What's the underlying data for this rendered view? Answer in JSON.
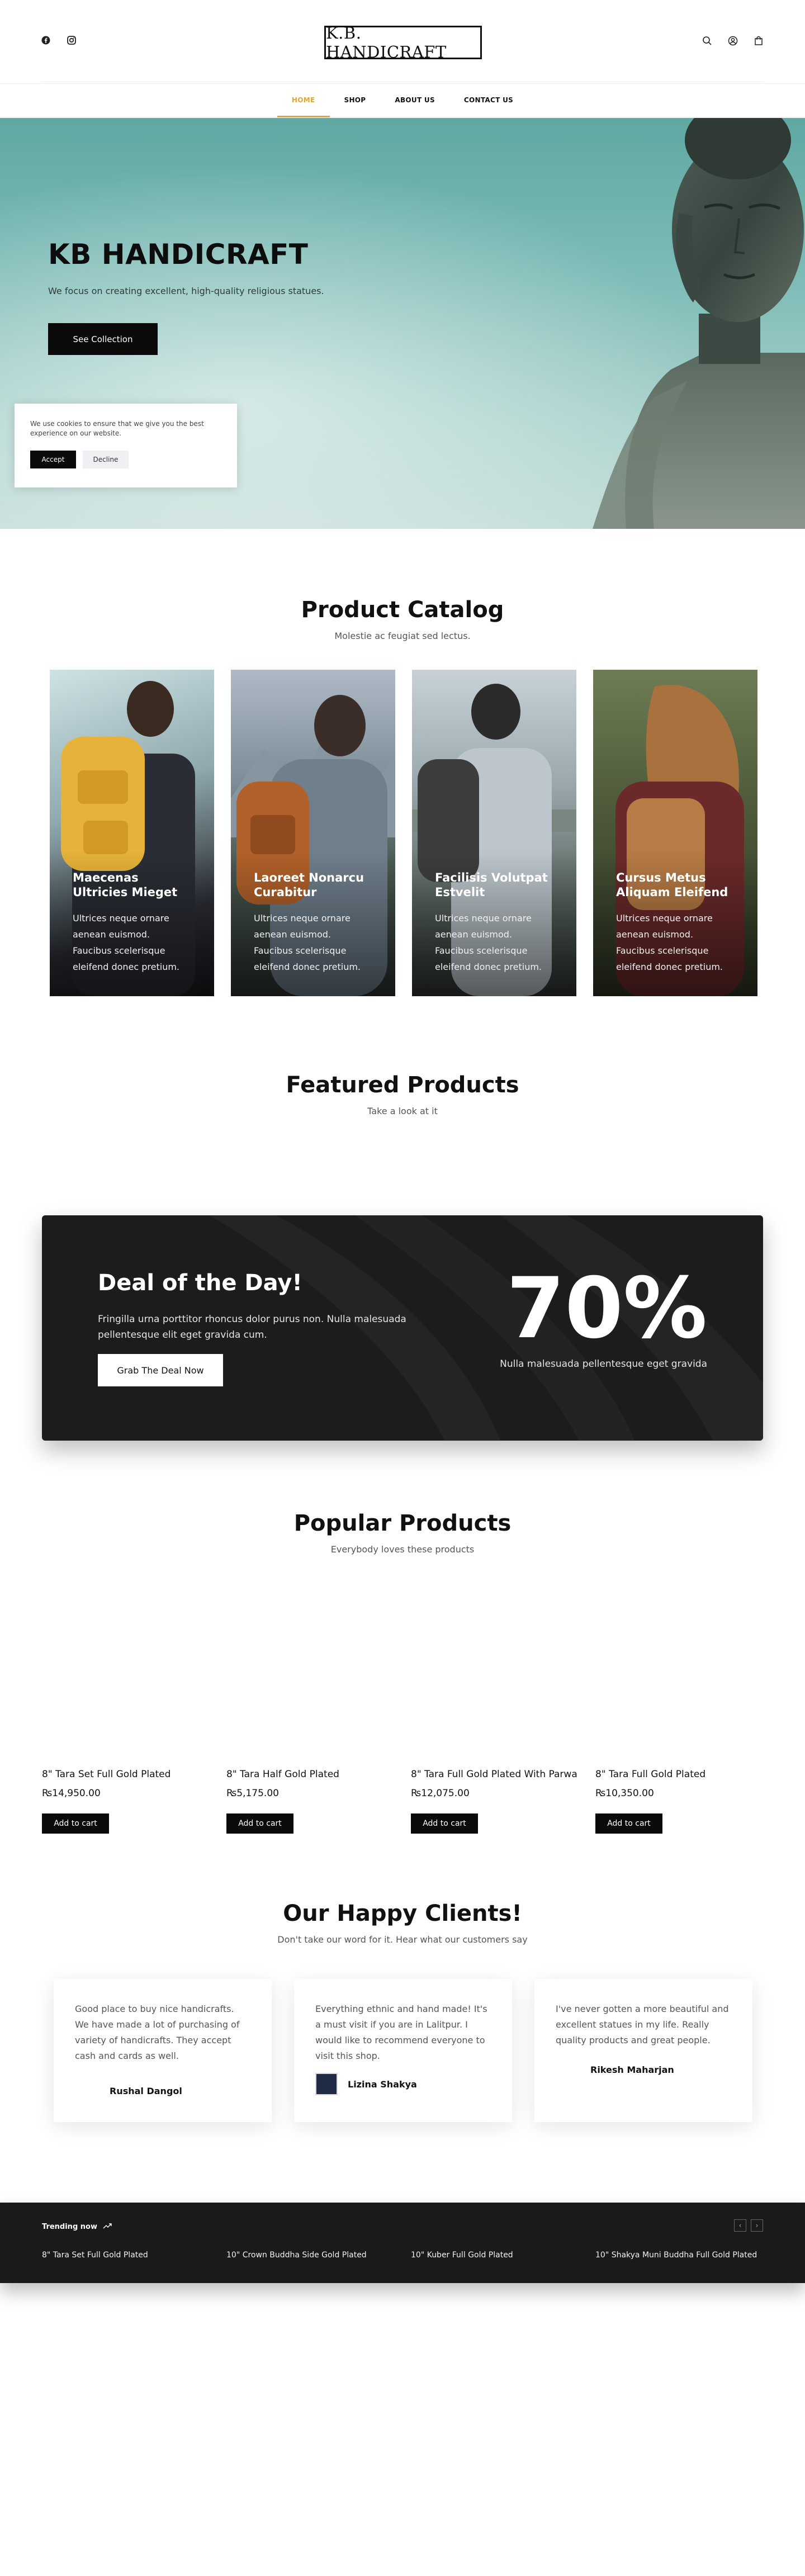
{
  "header": {
    "logo": "K.B. HANDICRAFT",
    "nav": [
      "HOME",
      "SHOP",
      "ABOUT US",
      "CONTACT US"
    ]
  },
  "hero": {
    "title": "KB HANDICRAFT",
    "subtitle": "We focus on creating excellent, high-quality religious statues.",
    "button": "See Collection"
  },
  "cookie": {
    "text": "We use cookies to ensure that we give you the best experience on our website.",
    "accept": "Accept",
    "decline": "Decline"
  },
  "catalog": {
    "title": "Product Catalog",
    "subtitle": "Molestie ac feugiat sed lectus.",
    "cards": [
      {
        "title": "Maecenas Ultricies Mieget",
        "text": "Ultrices neque ornare aenean euismod. Faucibus scelerisque eleifend donec pretium."
      },
      {
        "title": "Laoreet Nonarcu Curabitur",
        "text": "Ultrices neque ornare aenean euismod. Faucibus scelerisque eleifend donec pretium."
      },
      {
        "title": "Facilisis Volutpat Estvelit",
        "text": "Ultrices neque ornare aenean euismod. Faucibus scelerisque eleifend donec pretium."
      },
      {
        "title": "Cursus Metus Aliquam Eleifend",
        "text": "Ultrices neque ornare aenean euismod. Faucibus scelerisque eleifend donec pretium."
      }
    ]
  },
  "featured": {
    "title": "Featured Products",
    "subtitle": "Take a look at it"
  },
  "deal": {
    "title": "Deal of the Day!",
    "text": "Fringilla urna porttitor rhoncus dolor purus non. Nulla malesuada pellentesque elit eget gravida cum.",
    "button": "Grab The Deal Now",
    "percent": "70%",
    "percent_sub": "Nulla malesuada pellentesque eget gravida"
  },
  "popular": {
    "title": "Popular Products",
    "subtitle": "Everybody loves these products",
    "add_to_cart": "Add to cart",
    "products": [
      {
        "name": "8\" Tara Set Full Gold Plated",
        "price": "₨14,950.00"
      },
      {
        "name": "8\" Tara Half Gold Plated",
        "price": "₨5,175.00"
      },
      {
        "name": "8\" Tara Full Gold Plated With Parwa",
        "price": "₨12,075.00"
      },
      {
        "name": "8\" Tara Full Gold Plated",
        "price": "₨10,350.00"
      }
    ]
  },
  "clients": {
    "title": "Our Happy Clients!",
    "subtitle": "Don't take our word for it. Hear what our customers say",
    "items": [
      {
        "text": "Good place to buy nice handicrafts. We have made a lot of purchasing of variety of handicrafts. They accept cash and cards as well.",
        "name": "Rushal Dangol"
      },
      {
        "text": "Everything ethnic and hand made! It's a must visit if you are in Lalitpur.  I would like to recommend everyone to visit this shop.",
        "name": "Lizina Shakya"
      },
      {
        "text": "I've never gotten a more beautiful and excellent statues in my life. Really quality products and great people.",
        "name": "Rikesh Maharjan"
      }
    ]
  },
  "trending": {
    "label": "Trending now",
    "items": [
      "8\" Tara Set Full Gold Plated",
      "10\" Crown Buddha Side Gold Plated",
      "10\" Kuber Full Gold Plated",
      "10\" Shakya Muni Buddha Full Gold Plated"
    ]
  },
  "colors": {
    "accent": "#e3a431",
    "dark": "#1c1c1e"
  }
}
